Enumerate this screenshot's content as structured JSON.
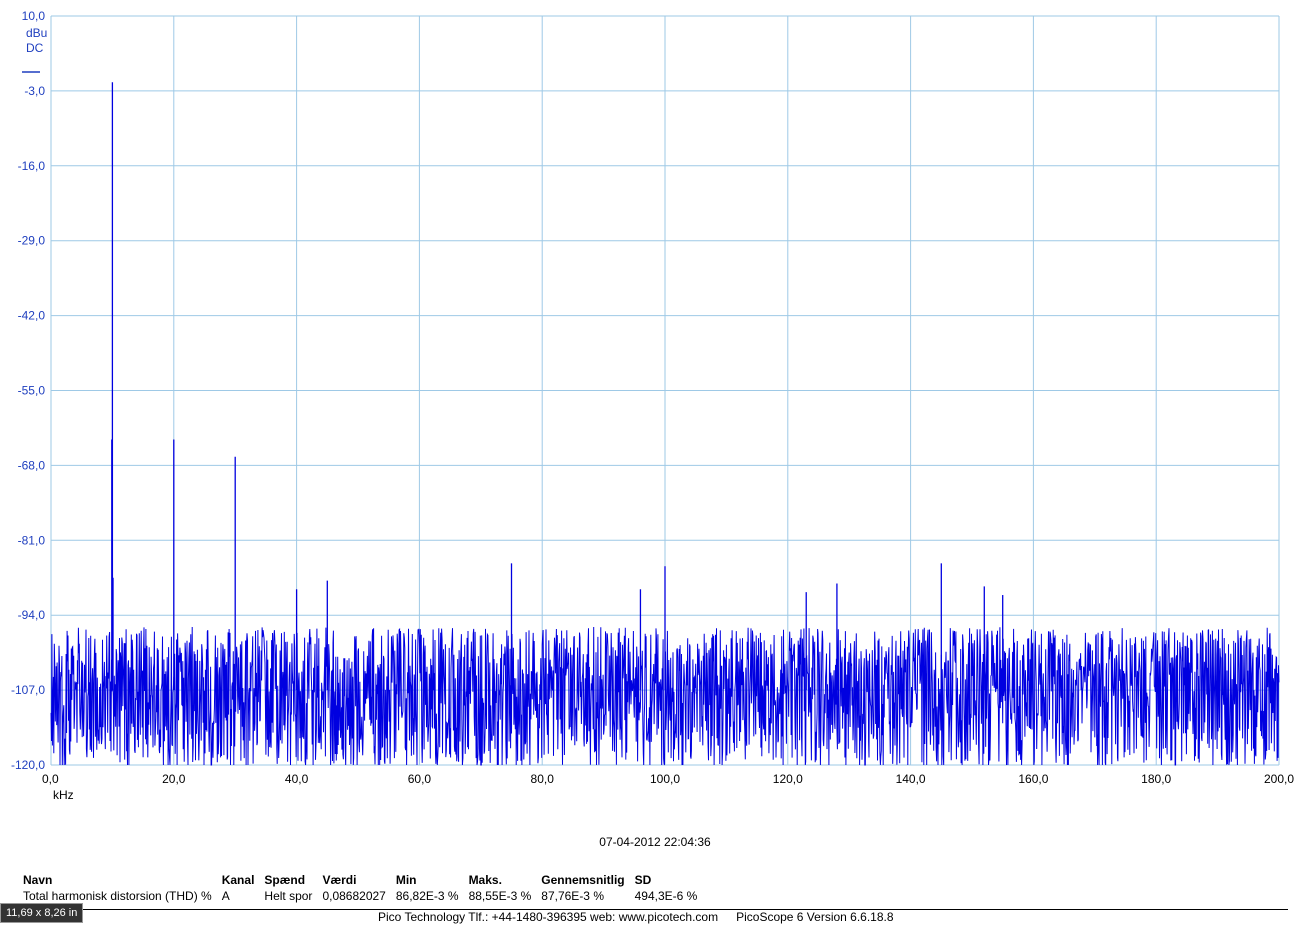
{
  "chart_data": {
    "type": "line",
    "y_unit": "dBu",
    "y_coupling": "DC",
    "x_unit": "kHz",
    "ylim": [
      -120.0,
      10.0
    ],
    "xlim": [
      0.0,
      200.0
    ],
    "y_ticks": [
      "10,0",
      "-3,0",
      "-16,0",
      "-29,0",
      "-42,0",
      "-55,0",
      "-68,0",
      "-81,0",
      "-94,0",
      "-107,0",
      "-120,0"
    ],
    "y_tick_values": [
      10,
      -3,
      -16,
      -29,
      -42,
      -55,
      -68,
      -81,
      -94,
      -107,
      -120
    ],
    "x_ticks": [
      "0,0",
      "20,0",
      "40,0",
      "60,0",
      "80,0",
      "100,0",
      "120,0",
      "140,0",
      "160,0",
      "180,0",
      "200,0"
    ],
    "x_tick_values": [
      0,
      20,
      40,
      60,
      80,
      100,
      120,
      140,
      160,
      180,
      200
    ],
    "grid": true,
    "series_color": "#0000e0",
    "noise_floor": {
      "mean": -107,
      "min": -120,
      "max": -96
    },
    "peaks": [
      {
        "x": 10.0,
        "y": -1.5
      },
      {
        "x": 9.9,
        "y": -63.5
      },
      {
        "x": 10.1,
        "y": -87.5
      },
      {
        "x": 20.0,
        "y": -63.5
      },
      {
        "x": 30.0,
        "y": -66.5
      },
      {
        "x": 40.0,
        "y": -89.5
      },
      {
        "x": 45.0,
        "y": -88.0
      },
      {
        "x": 75.0,
        "y": -85.0
      },
      {
        "x": 96.0,
        "y": -89.5
      },
      {
        "x": 100.0,
        "y": -85.5
      },
      {
        "x": 123.0,
        "y": -90.0
      },
      {
        "x": 128.0,
        "y": -88.5
      },
      {
        "x": 145.0,
        "y": -85.0
      },
      {
        "x": 152.0,
        "y": -89.0
      },
      {
        "x": 155.0,
        "y": -90.5
      }
    ]
  },
  "timestamp": "07-04-2012 22:04:36",
  "measurements": {
    "headers": [
      "Navn",
      "Kanal",
      "Spænd",
      "Værdi",
      "Min",
      "Maks.",
      "Gennemsnitlig",
      "SD"
    ],
    "rows": [
      [
        "Total harmonisk distorsion (THD) %",
        "A",
        "Helt spor",
        "0,08682027",
        "86,82E-3 %",
        "88,55E-3 %",
        "87,76E-3 %",
        "494,3E-6 %"
      ]
    ]
  },
  "footer": {
    "company": "Pico Technology Tlf.: +44-1480-396395  web: www.picotech.com",
    "version": "PicoScope 6 Version 6.6.18.8"
  },
  "size_badge": "11,69 x 8,26 in",
  "colors": {
    "grid": "#9ec9e6",
    "axis_label": "#1f3fbf",
    "trace": "#0000e0"
  }
}
